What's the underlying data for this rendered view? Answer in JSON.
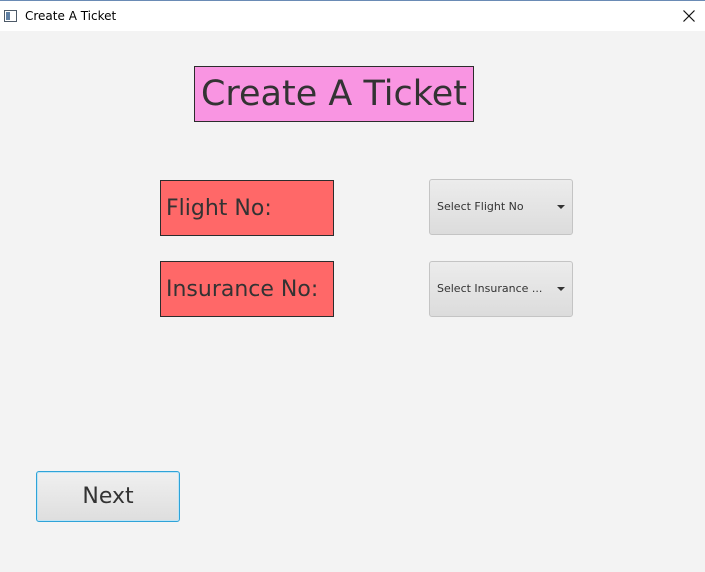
{
  "window": {
    "title": "Create A Ticket"
  },
  "form": {
    "heading": "Create A Ticket",
    "flight_label": "Flight No:",
    "insurance_label": "Insurance No:",
    "flight_select_value": "Select Flight No",
    "insurance_select_value": "Select Insurance ..."
  },
  "actions": {
    "next_label": "Next"
  },
  "colors": {
    "heading_bg": "#f995e2",
    "label_bg": "#ff6868",
    "window_bg": "#f3f3f3",
    "focus_border": "#2ea3d8"
  },
  "icons": {
    "window": "app-window-icon",
    "close": "close-icon",
    "dropdown": "chevron-down-icon"
  }
}
